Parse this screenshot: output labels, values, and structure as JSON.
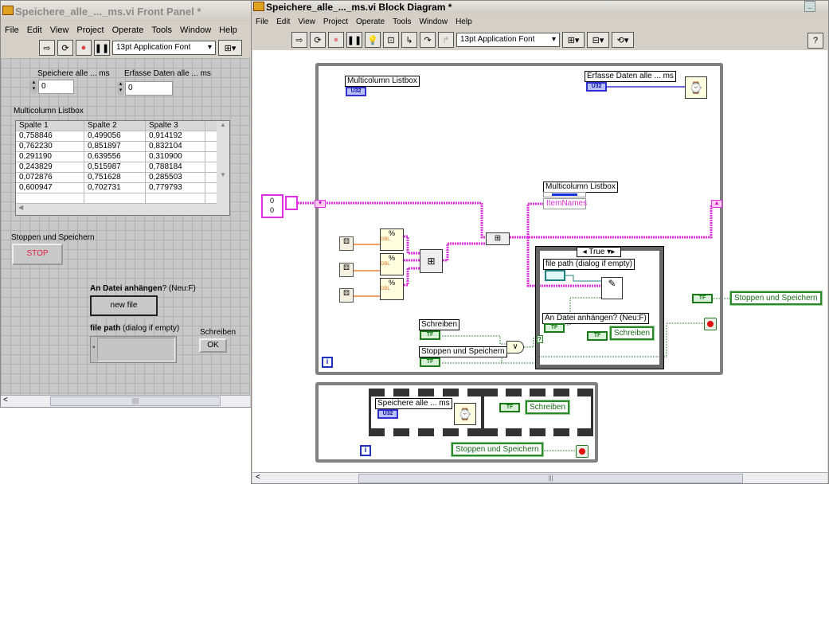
{
  "front_panel": {
    "title": "Speichere_alle_..._ms.vi Front Panel *",
    "menu": [
      "File",
      "Edit",
      "View",
      "Project",
      "Operate",
      "Tools",
      "Window",
      "Help"
    ],
    "font": "13pt Application Font",
    "speichere": {
      "label": "Speichere alle ... ms",
      "value": "0"
    },
    "erfasse": {
      "label": "Erfasse Daten alle ... ms",
      "value": "0"
    },
    "listbox": {
      "label": "Multicolumn Listbox",
      "headers": [
        "Spalte 1",
        "Spalte 2",
        "Spalte 3"
      ],
      "rows": [
        [
          "0,758846",
          "0,499056",
          "0,914192"
        ],
        [
          "0,762230",
          "0,851897",
          "0,832104"
        ],
        [
          "0,291190",
          "0,639556",
          "0,310900"
        ],
        [
          "0,243829",
          "0,515987",
          "0,788184"
        ],
        [
          "0,072876",
          "0,751628",
          "0,285503"
        ],
        [
          "0,600947",
          "0,702731",
          "0,779793"
        ]
      ]
    },
    "stop": {
      "label": "Stoppen und Speichern",
      "button": "STOP"
    },
    "append": {
      "label_bold": "An Datei anhängen",
      "label_rest": "? (Neu:F)",
      "button": "new file"
    },
    "filepath": {
      "label_bold": "file path",
      "label_rest": " (dialog if empty)"
    },
    "schreiben": {
      "label": "Schreiben",
      "button": "OK"
    }
  },
  "block_diagram": {
    "title": "Speichere_alle_..._ms.vi Block Diagram *",
    "menu": [
      "File",
      "Edit",
      "View",
      "Project",
      "Operate",
      "Tools",
      "Window",
      "Help"
    ],
    "font": "13pt Application Font",
    "listbox_label": "Multicolumn Listbox",
    "u32": "U32",
    "erfasse_label": "Erfasse Daten alle ... ms",
    "cluster_values": [
      "0",
      "0"
    ],
    "property_label": "Multicolumn Listbox",
    "property_name": "ItemNames",
    "dbl": "DBL",
    "case_selector": "True",
    "filepath_label": "file path (dialog if empty)",
    "append_label": "An Datei anhängen? (Neu:F)",
    "schreiben_label": "Schreiben",
    "stoppen_label": "Stoppen und Speichern",
    "tf": "TF",
    "schreiben_local": "Schreiben",
    "stoppen_local": "Stoppen und Speichern",
    "speichere_label": "Speichere alle ... ms",
    "info": "i",
    "case_q": "?"
  }
}
